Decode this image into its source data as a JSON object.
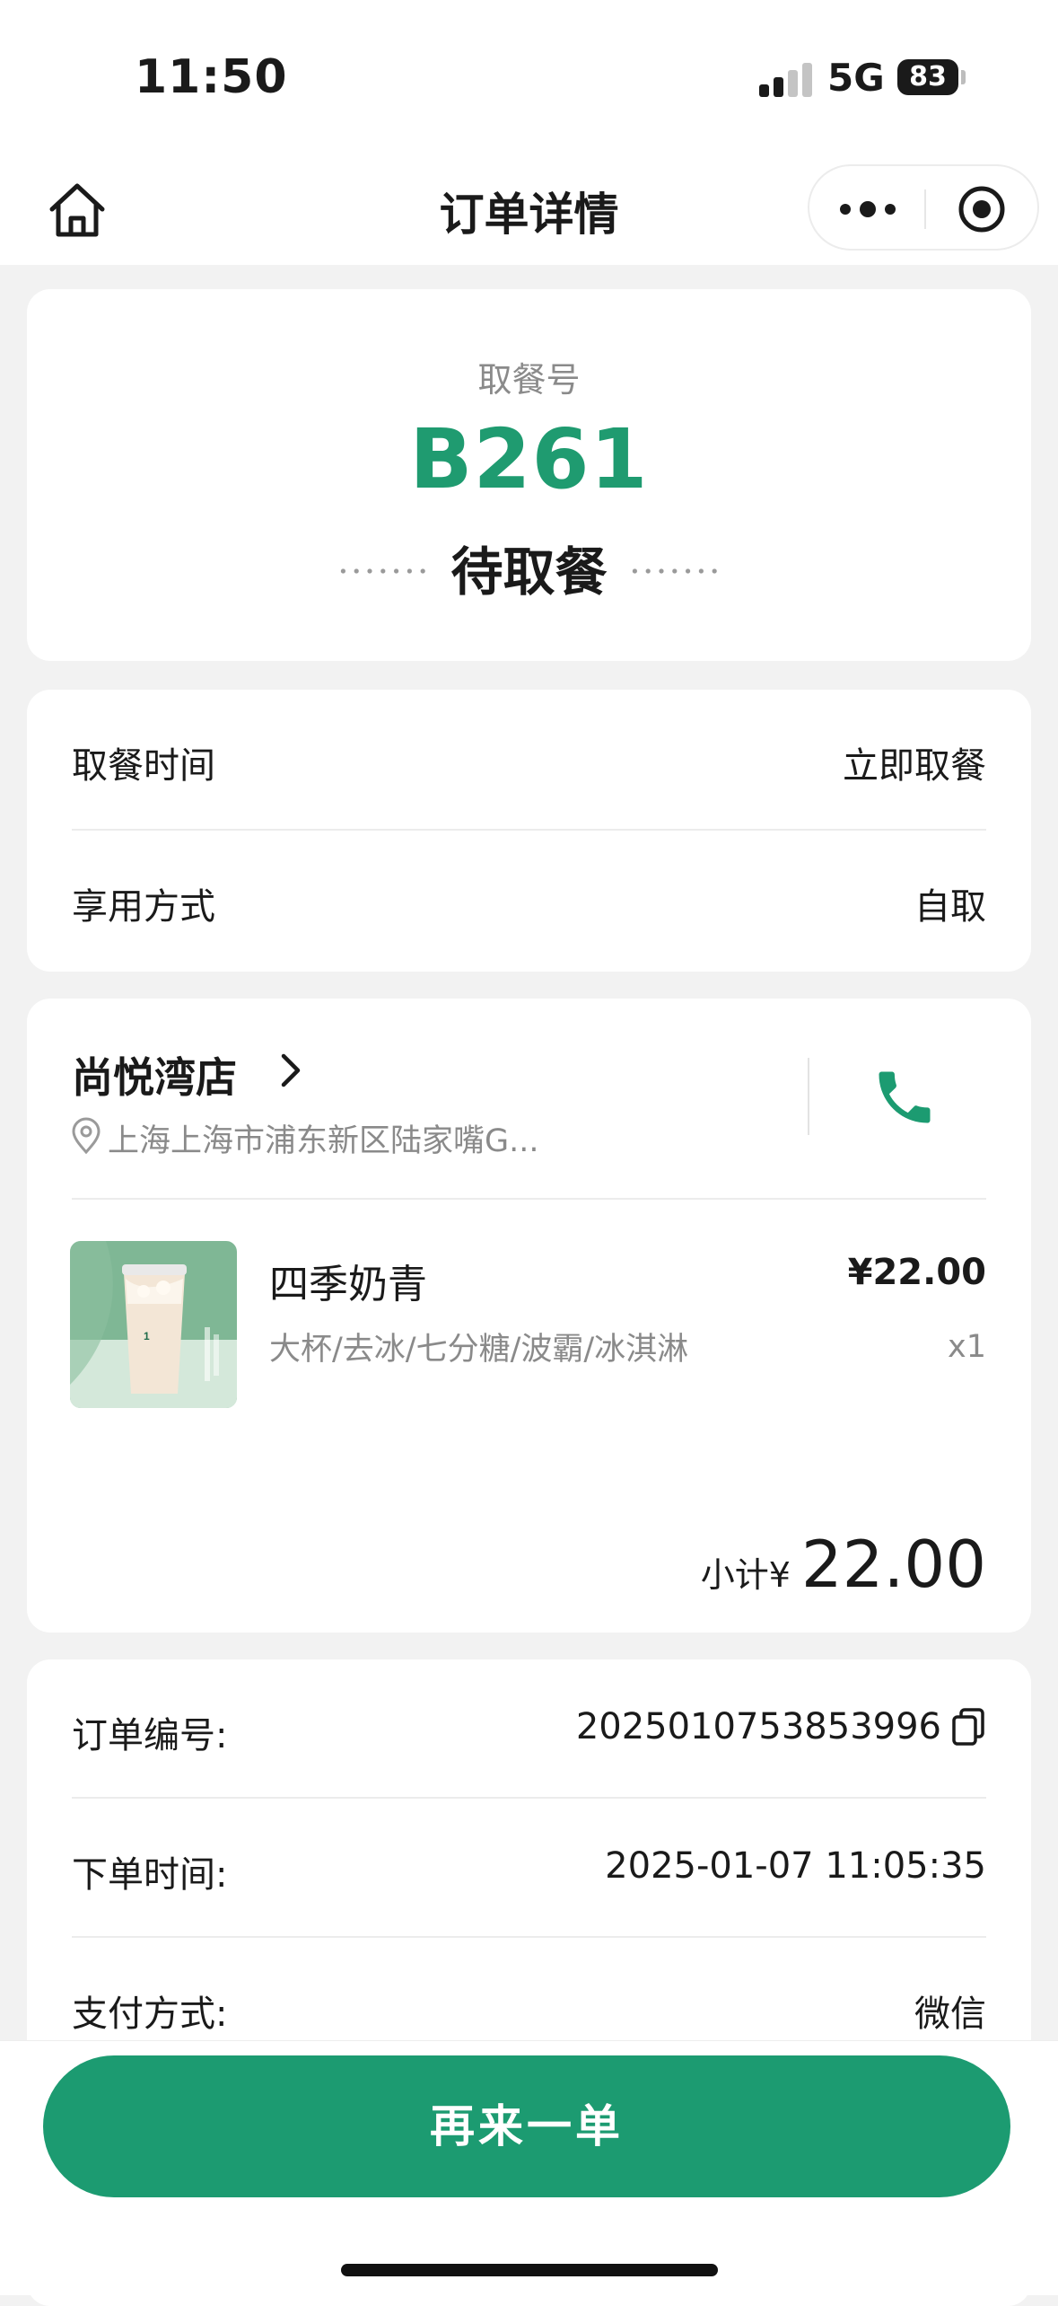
{
  "status_bar": {
    "time": "11:50",
    "network": "5G",
    "battery": "83"
  },
  "nav": {
    "title": "订单详情"
  },
  "pickup": {
    "label": "取餐号",
    "number": "B261",
    "status": "待取餐"
  },
  "info": [
    {
      "key": "取餐时间",
      "value": "立即取餐"
    },
    {
      "key": "享用方式",
      "value": "自取"
    }
  ],
  "store": {
    "name": "尚悦湾店",
    "address": "上海上海市浦东新区陆家嘴G..."
  },
  "product": {
    "name": "四季奶青",
    "spec": "大杯/去冰/七分糖/波霸/冰淇淋",
    "price": "¥22.00",
    "qty": "x1"
  },
  "subtotal": {
    "label": "小计¥",
    "amount": "22.00"
  },
  "order": [
    {
      "key": "订单编号:",
      "value": "2025010753853996"
    },
    {
      "key": "下单时间:",
      "value": "2025-01-07 11:05:35"
    },
    {
      "key": "支付方式:",
      "value": "微信"
    }
  ],
  "actions": {
    "reorder": "再来一单"
  },
  "colors": {
    "accent": "#1c9b71",
    "accent_text": "#1f9b70"
  }
}
